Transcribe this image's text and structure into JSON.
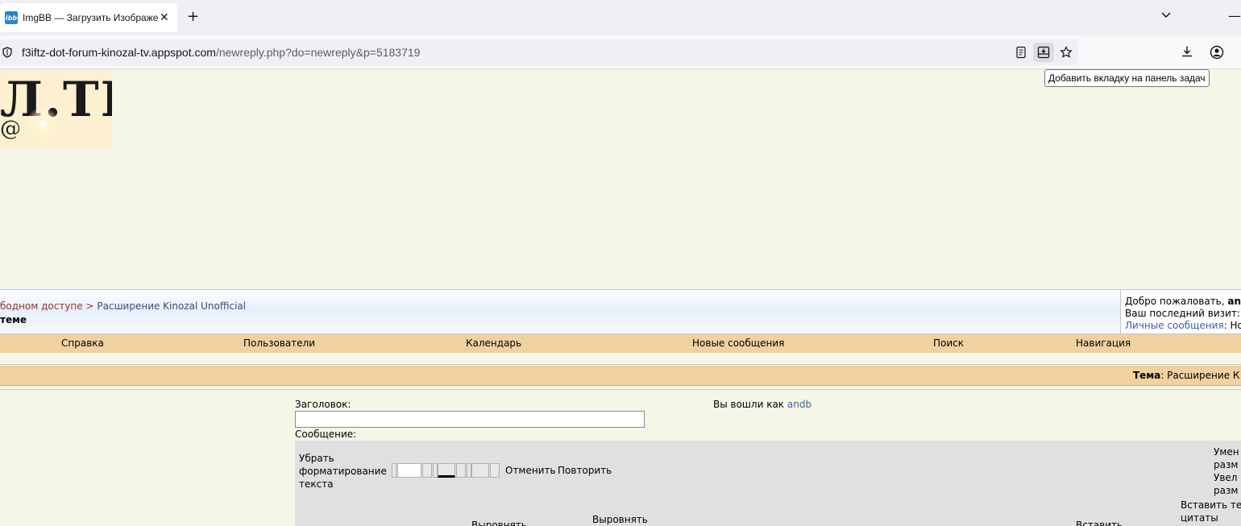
{
  "browser": {
    "tab_title": "ImgBB — Загрузить Изображе",
    "favicon_text": "ibb",
    "url_host": "f3iftz-dot-forum-kinozal-tv.appspot.com",
    "url_path": "/newreply.php?do=newreply&p=5183719",
    "tooltip": "Добавить вкладку на панель задач"
  },
  "logo": {
    "text": "Л.ТВ",
    "at": "@"
  },
  "header": {
    "breadcrumb_1": "бодном доступе",
    "breadcrumb_sep": ">",
    "breadcrumb_2": "Расширение Kinozal Unofficial",
    "subtitle": "теме"
  },
  "user_panel": {
    "welcome": "Добро пожаловать, ",
    "username": "anc",
    "last_visit": "Ваш последний визит: ",
    "pm_link": "Личные сообщения",
    "pm_rest": ": Но"
  },
  "nav": {
    "items": [
      "Справка",
      "Пользователи",
      "Календарь",
      "Новые сообщения",
      "Поиск",
      "Навигация"
    ]
  },
  "thread": {
    "label": "Тема",
    "value": ": Расширение К"
  },
  "form": {
    "title_label": "Заголовок:",
    "logged_in_as": "Вы вошли как ",
    "logged_in_user": "andb",
    "message_label": "Сообщение:",
    "title_value": ""
  },
  "editor": {
    "clear_format": "Убрать форматирование текста",
    "undo": "Отменить",
    "redo": "Повторить",
    "shrink_1": "Умен",
    "shrink_2": "разм",
    "grow_1": "Увел",
    "grow_2": "разм",
    "align_1": "Выровнять",
    "align_2": "Выровнять",
    "insert_quote_1": "Вставить те",
    "insert_quote_2": "цитаты",
    "insert": "Вставить"
  }
}
